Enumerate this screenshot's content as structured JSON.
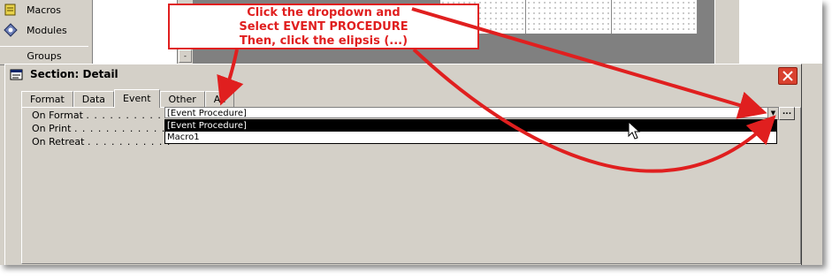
{
  "background_window": {
    "nav_items": [
      {
        "label": "Macros",
        "icon": "macro-icon"
      },
      {
        "label": "Modules",
        "icon": "module-icon"
      }
    ],
    "groups_label": "Groups"
  },
  "dialog": {
    "title": "Section: Detail",
    "tabs": [
      "Format",
      "Data",
      "Event",
      "Other",
      "All"
    ],
    "active_tab": "Event",
    "properties": [
      {
        "label": "On Format",
        "dots": ". . . . . . . . . . ."
      },
      {
        "label": "On Print",
        "dots": ". . . . . . . . . . . . ."
      },
      {
        "label": "On Retreat",
        "dots": ". . . . . . . . . . ."
      }
    ],
    "on_format_value": "[Event Procedure]",
    "dropdown_options": [
      "[Event Procedure]",
      "Macro1"
    ],
    "selected_option": "[Event Procedure]",
    "ellipsis_label": "..."
  },
  "annotation": {
    "lines": [
      "Click the dropdown and",
      "Select EVENT PROCEDURE",
      "Then, click the elipsis (...)"
    ],
    "color": "#e01f1f"
  },
  "colors": {
    "window_face": "#d4d0c8",
    "close_button": "#d9412f",
    "selection": "#000000"
  }
}
